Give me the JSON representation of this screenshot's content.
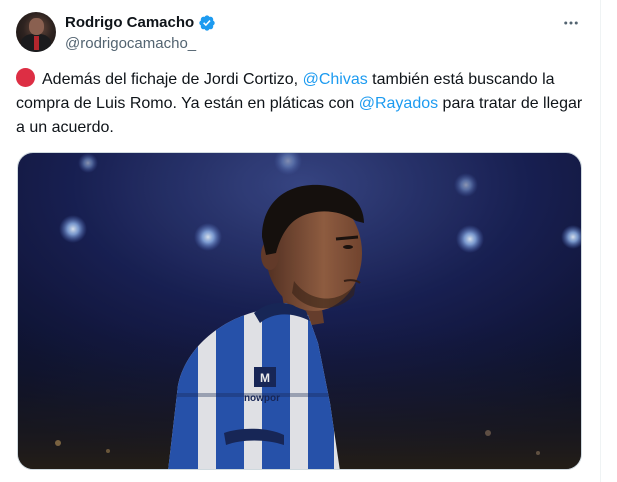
{
  "author": {
    "display_name": "Rodrigo Camacho",
    "handle": "@rodrigocamacho_",
    "verified": true
  },
  "tweet": {
    "indicator_color": "#dd2e44",
    "text_part1": "Además del fichaje de Jordi Cortizo, ",
    "mention1": "@Chivas",
    "text_part2": " también está buscando la compra de Luis Romo. Ya están en pláticas con ",
    "mention2": "@Rayados",
    "text_part3": " para tratar de llegar a un acuerdo."
  },
  "media": {
    "jersey_sponsor": "nowpor"
  },
  "icons": {
    "verified": "verified-badge-icon",
    "more": "more-options-icon"
  },
  "colors": {
    "mention": "#1d9bf0",
    "verified_badge": "#1d9bf0",
    "text": "#0f1419",
    "secondary": "#536471"
  }
}
